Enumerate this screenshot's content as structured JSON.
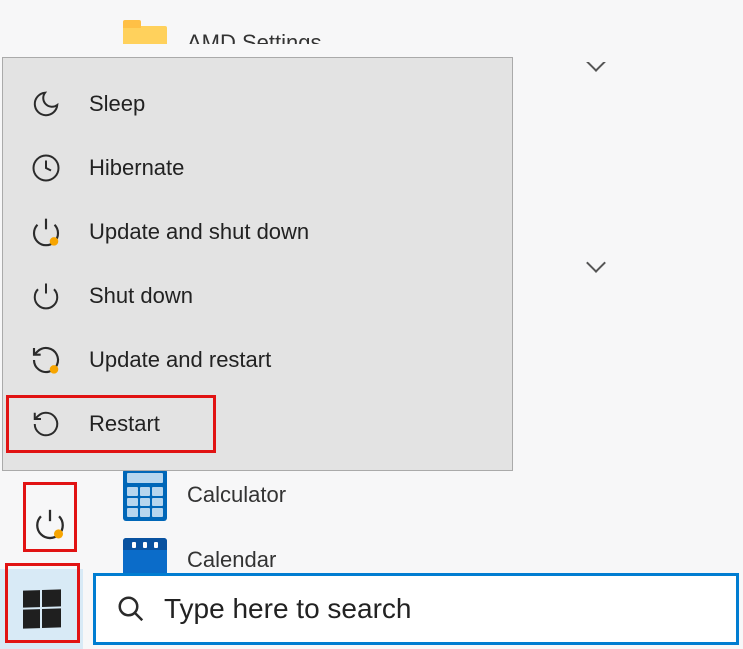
{
  "background": {
    "folder_label": "AMD Settings",
    "calculator_label": "Calculator",
    "calendar_label": "Calendar"
  },
  "power_menu": {
    "items": [
      {
        "id": "sleep",
        "label": "Sleep",
        "icon": "moon-icon"
      },
      {
        "id": "hibernate",
        "label": "Hibernate",
        "icon": "clock-icon"
      },
      {
        "id": "update-shutdown",
        "label": "Update and shut down",
        "icon": "power-update-icon"
      },
      {
        "id": "shutdown",
        "label": "Shut down",
        "icon": "power-icon"
      },
      {
        "id": "update-restart",
        "label": "Update and restart",
        "icon": "restart-update-icon"
      },
      {
        "id": "restart",
        "label": "Restart",
        "icon": "restart-icon"
      }
    ]
  },
  "search": {
    "placeholder": "Type here to search"
  }
}
